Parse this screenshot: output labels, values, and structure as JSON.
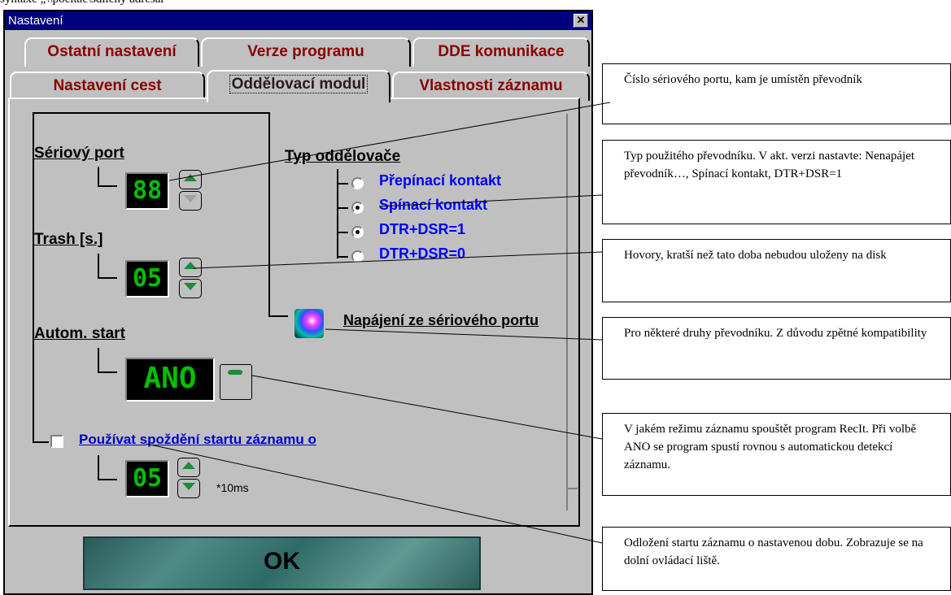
{
  "document": {
    "top_text": "syntaxe „\\\\počítač\\sdílený adresář"
  },
  "window": {
    "title": "Nastavení",
    "close_glyph": "✕"
  },
  "tabs": {
    "row1": [
      "Ostatní nastavení",
      "Verze programu",
      "DDE komunikace"
    ],
    "row2": [
      "Nastavení cest",
      "Oddělovací modul",
      "Vlastnosti záznamu"
    ],
    "active": "Oddělovací modul"
  },
  "settings": {
    "serial_port": {
      "label": "Sériový port",
      "display": "88"
    },
    "trash": {
      "label": "Trash [s.]",
      "display": "05"
    },
    "autostart": {
      "label": "Autom. start",
      "display": "ANO"
    },
    "delay": {
      "checkbox_label": "Používat spoždění startu záznamu o",
      "checked": false,
      "display": "05",
      "unit": "*10ms"
    },
    "separator_type": {
      "label": "Typ oddělovače",
      "options": [
        "Přepínací kontakt",
        "Spínací kontakt",
        "DTR+DSR=1",
        "DTR+DSR=0"
      ],
      "selected": [
        "Spínací kontakt",
        "DTR+DSR=1"
      ]
    },
    "power": {
      "label": "Napájení ze sériového portu"
    }
  },
  "ok_button": {
    "label": "OK"
  },
  "callouts": [
    "Číslo sériového portu, kam je umístěn převodník",
    "Typ použitého převodníku. V akt. verzi nastavte: Nenapájet převodník…, Spínací kontakt, DTR+DSR=1",
    "Hovory, kratší než tato doba nebudou uloženy na disk",
    "Pro některé druhy převodníku. Z důvodu zpětné kompatibility",
    "V jakém režimu záznamu spouštět program RecIt. Při volbě ANO se program spustí rovnou s automatickou detekcí záznamu.",
    "Odložení startu záznamu o nastavenou dobu. Zobrazuje se na dolní ovládací liště."
  ],
  "colors": {
    "title_bar": "#000080",
    "radio_text": "#0000ff",
    "led_green": "#00c000",
    "tab_text": "#8b0000"
  }
}
